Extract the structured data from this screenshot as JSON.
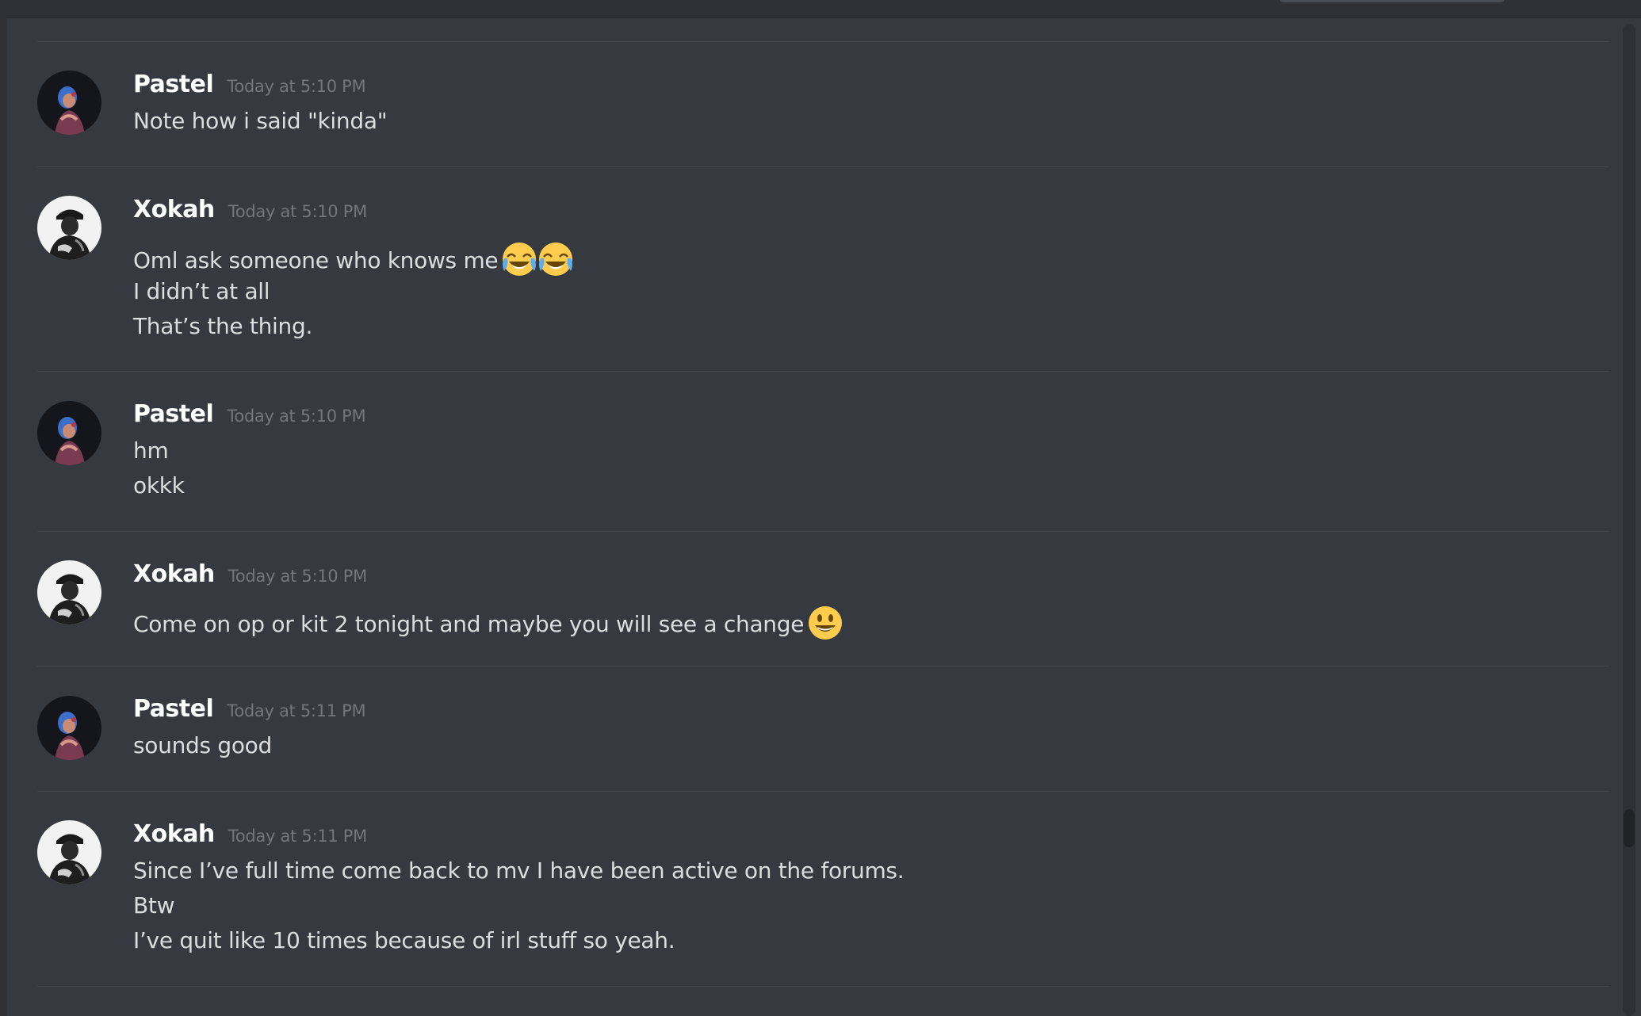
{
  "messages": [
    {
      "author": "Pastel",
      "avatar_icon": "user-avatar-pastel",
      "timestamp": "Today at 5:10 PM",
      "lines": [
        "Note how i said \"kinda\""
      ]
    },
    {
      "author": "Xokah",
      "avatar_icon": "user-avatar-xokah",
      "timestamp": "Today at 5:10 PM",
      "lines": [
        "Oml ask someone who knows me",
        "I didn’t at all",
        "That’s the thing."
      ],
      "emoji": [
        "face-with-tears-of-joy-icon",
        "face-with-tears-of-joy-icon"
      ]
    },
    {
      "author": "Pastel",
      "avatar_icon": "user-avatar-pastel",
      "timestamp": "Today at 5:10 PM",
      "lines": [
        "hm",
        "okkk"
      ]
    },
    {
      "author": "Xokah",
      "avatar_icon": "user-avatar-xokah",
      "timestamp": "Today at 5:10 PM",
      "lines": [
        "Come on op or kit 2 tonight and maybe you will see a change"
      ],
      "emoji": [
        "smiling-face-icon"
      ]
    },
    {
      "author": "Pastel",
      "avatar_icon": "user-avatar-pastel",
      "timestamp": "Today at 5:11 PM",
      "lines": [
        "sounds good"
      ]
    },
    {
      "author": "Xokah",
      "avatar_icon": "user-avatar-xokah",
      "timestamp": "Today at 5:11 PM",
      "lines": [
        "Since I’ve full time come back to mv I have been active on the forums.",
        "Btw",
        "I’ve quit like 10 times because of irl stuff so yeah."
      ]
    }
  ],
  "colors": {
    "background": "#36393f",
    "username": "#ffffff",
    "timestamp": "#72767d",
    "message_text": "#dcddde",
    "divider": "#42454b"
  }
}
